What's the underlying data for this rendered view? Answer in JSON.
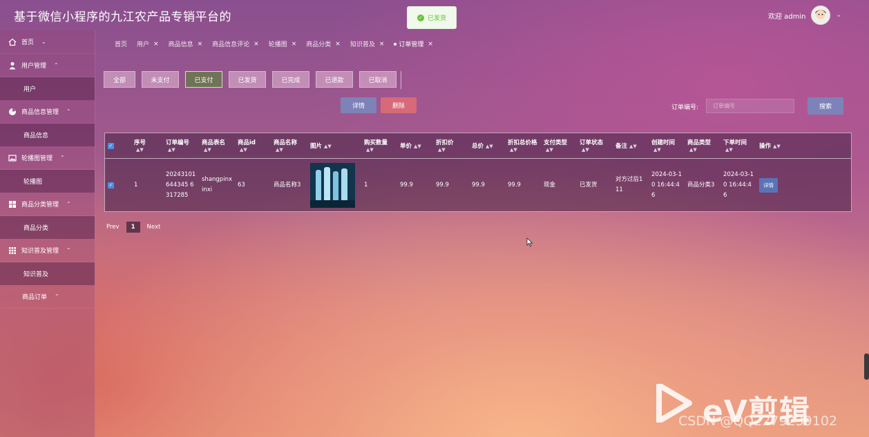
{
  "header": {
    "title": "基于微信小程序的九江农产品专销平台的",
    "welcome": "欢迎 admin"
  },
  "toast": {
    "message": "已发货"
  },
  "sidebar": {
    "items": [
      {
        "label": "首页",
        "icon": "home-icon"
      },
      {
        "label": "用户管理",
        "icon": "user-icon",
        "sub": "用户"
      },
      {
        "label": "商品信息管理",
        "icon": "pie-icon",
        "sub": "商品信息"
      },
      {
        "label": "轮播图管理",
        "icon": "image-icon",
        "sub": "轮播图"
      },
      {
        "label": "商品分类管理",
        "icon": "grid-icon",
        "sub": "商品分类"
      },
      {
        "label": "知识普及管理",
        "icon": "apps-icon",
        "sub": "知识普及"
      },
      {
        "label": "商品订单"
      }
    ]
  },
  "tabs": [
    "首页",
    "用户",
    "商品信息",
    "商品信息评论",
    "轮播图",
    "商品分类",
    "知识普及",
    "订单管理"
  ],
  "status_filters": [
    "全部",
    "未支付",
    "已支付",
    "已发货",
    "已完成",
    "已退款",
    "已取消"
  ],
  "status_active": "已支付",
  "actions": {
    "detail": "详情",
    "delete": "删除",
    "search": "搜索"
  },
  "search": {
    "label": "订单编号:",
    "placeholder": "订单编号"
  },
  "table": {
    "columns": [
      "序号",
      "订单编号",
      "商品表名",
      "商品id",
      "商品名称",
      "图片",
      "购买数量",
      "单价",
      "折扣价",
      "总价",
      "折扣总价格",
      "支付类型",
      "订单状态",
      "备注",
      "创建时间",
      "商品类型",
      "下单时间",
      "操作"
    ],
    "rows": [
      {
        "index": "1",
        "order_no": "20243101644345 6317285",
        "table_name": "shangpinxinxi",
        "product_id": "63",
        "product_name": "商品名称3",
        "quantity": "1",
        "unit_price": "99.9",
        "discount_price": "99.9",
        "total": "99.9",
        "discount_total": "99.9",
        "pay_type": "现金",
        "status": "已发货",
        "remark": "对方过后111",
        "created": "2024-03-10 16:44:46",
        "category": "商品分类3",
        "order_time": "2024-03-10 16:44:46",
        "op": "详情"
      }
    ]
  },
  "pager": {
    "prev": "Prev",
    "page": "1",
    "next": "Next"
  },
  "watermark": {
    "brand": "eV剪辑",
    "csdn": "CSDN @QQ2279239102"
  }
}
